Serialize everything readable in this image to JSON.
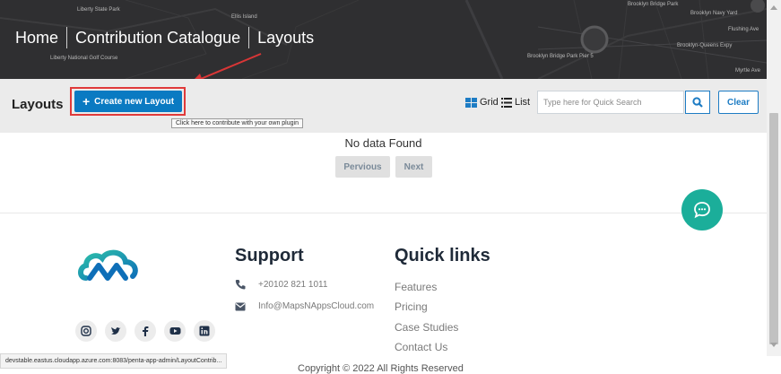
{
  "breadcrumb": {
    "items": [
      "Home",
      "Contribution Catalogue",
      "Layouts"
    ]
  },
  "map_labels": {
    "a": "Brooklyn Bridge Park",
    "b": "Brooklyn Navy Yard",
    "c": "Brooklyn-Queens Expy",
    "d": "Brooklyn Bridge Park Pier 5",
    "e": "Ellis Island",
    "f": "Liberty National Golf Course",
    "g": "Liberty State Park",
    "h": "Myrtle Ave",
    "i": "Flushing Ave"
  },
  "toolbar": {
    "heading": "Layouts",
    "create_label": "Create new Layout",
    "create_tooltip": "Click here to contribute with your own plugin",
    "grid_label": "Grid",
    "list_label": "List",
    "search_placeholder": "Type here for Quick Search",
    "clear_label": "Clear"
  },
  "content": {
    "empty_text": "No data Found",
    "prev_label": "Pervious",
    "next_label": "Next"
  },
  "footer": {
    "support_heading": "Support",
    "phone": "+20102 821 1011",
    "email": "Info@MapsNAppsCloud.com",
    "quick_heading": "Quick links",
    "quick_links": [
      "Features",
      "Pricing",
      "Case Studies",
      "Contact Us"
    ],
    "socials": [
      "instagram-icon",
      "twitter-icon",
      "facebook-icon",
      "youtube-icon",
      "linkedin-icon"
    ],
    "copyright": "Copyright © 2022 All Rights Reserved"
  },
  "status_url": "devstable.eastus.cloudapp.azure.com:8083/penta-app-admin/LayoutContrib...",
  "colors": {
    "primary": "#0a7ac2",
    "highlight": "#e03a3a",
    "chat": "#1bae9a",
    "banner": "#2f2f31",
    "heading_dark": "#1f2a38"
  }
}
